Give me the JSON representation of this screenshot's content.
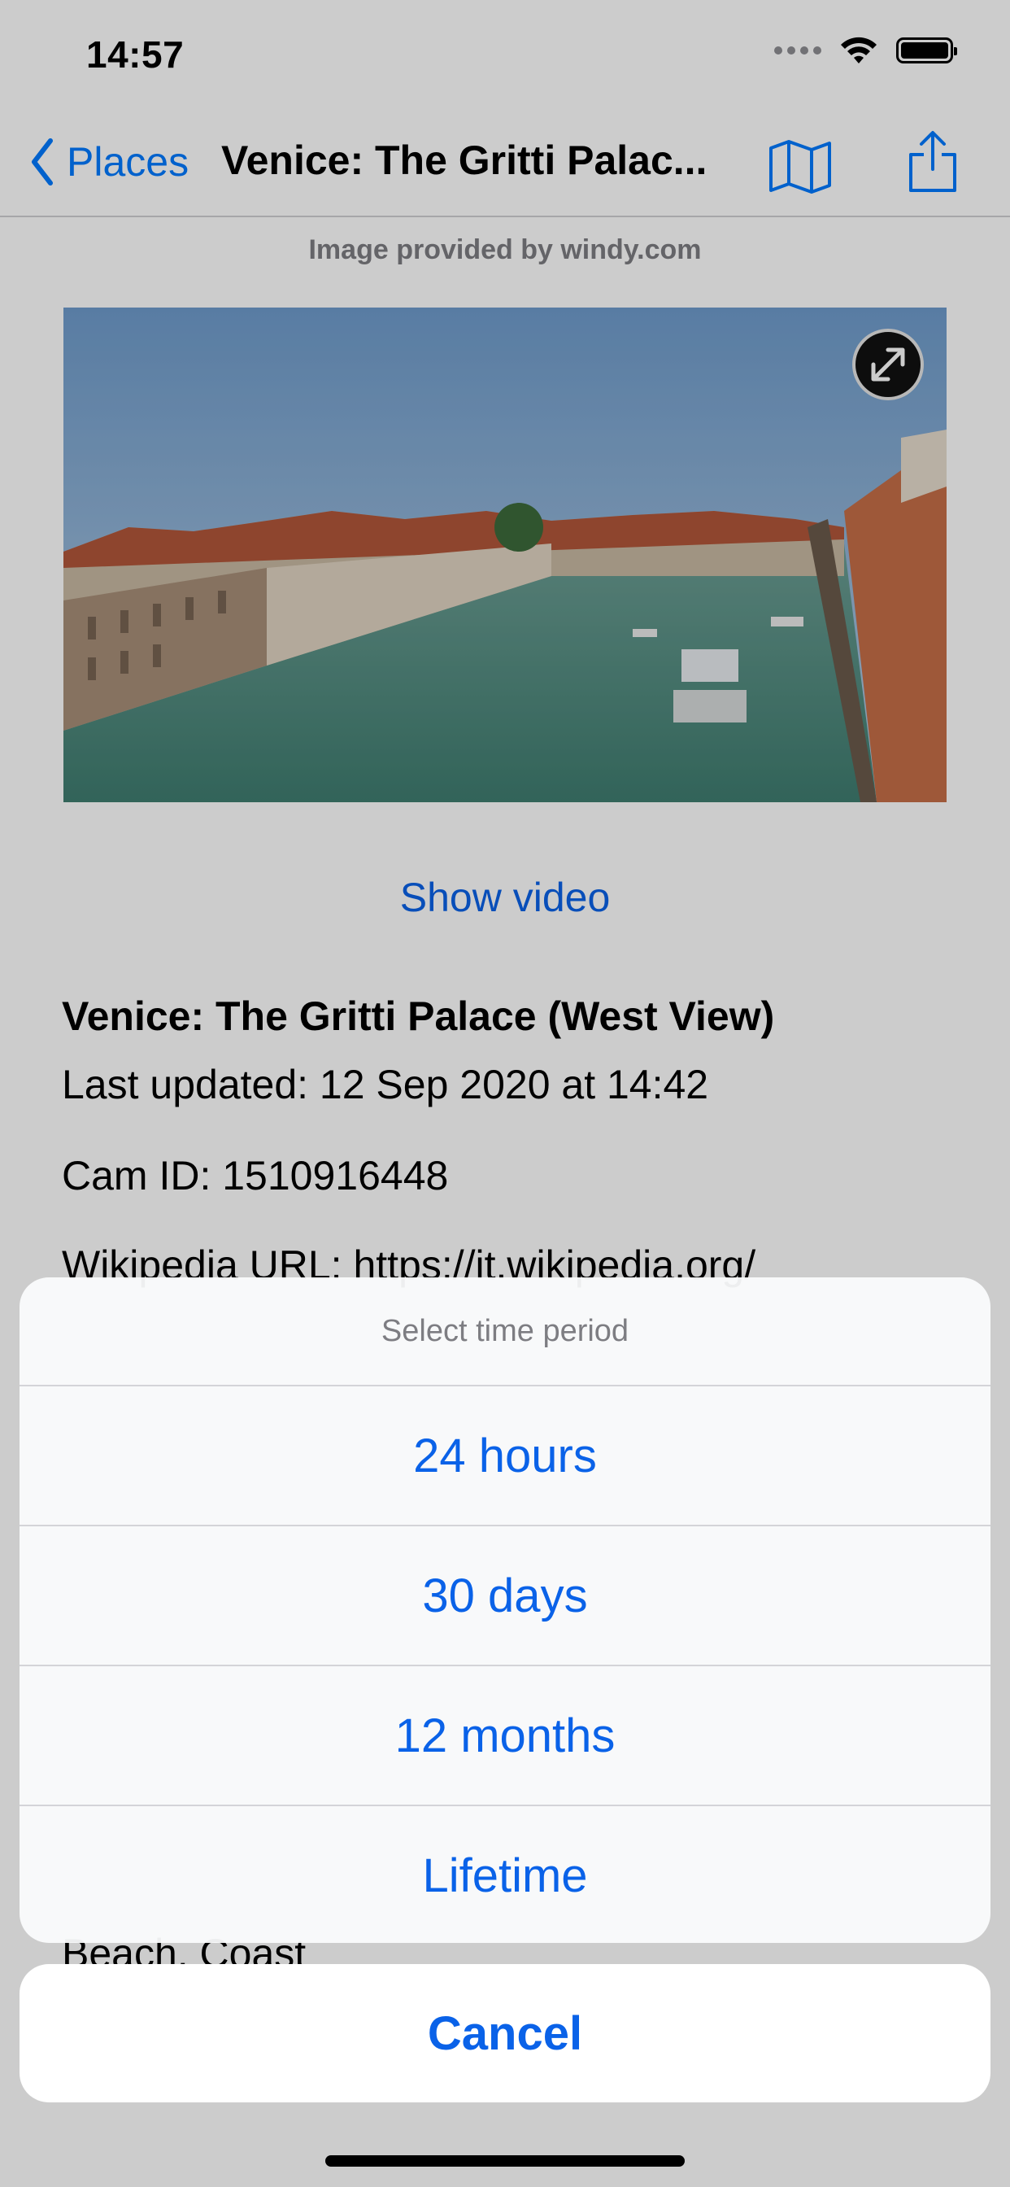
{
  "status_bar": {
    "time": "14:57",
    "icons": [
      "signal-dots-icon",
      "wifi-icon",
      "battery-icon"
    ]
  },
  "nav": {
    "back_label": "Places",
    "title": "Venice: The Gritti Palac...",
    "icons": [
      "chevron-left-icon",
      "map-icon",
      "share-icon"
    ]
  },
  "content": {
    "provided_by": "Image provided by windy.com",
    "show_video": "Show video",
    "cam_title": "Venice: The Gritti Palace (West View)",
    "last_updated": "Last updated: 12 Sep 2020 at 14:42",
    "cam_id": "Cam ID: 1510916448",
    "wikipedia": "Wikipedia URL: https://it.wikipedia.org/",
    "categories": "Beach, Coast"
  },
  "action_sheet": {
    "title": "Select time period",
    "options": [
      "24 hours",
      "30 days",
      "12 months",
      "Lifetime"
    ],
    "cancel": "Cancel"
  },
  "colors": {
    "accent": "#0a62e8",
    "water": "#4f8f84",
    "sky": "#84a9d0",
    "roof": "#c46a48"
  }
}
